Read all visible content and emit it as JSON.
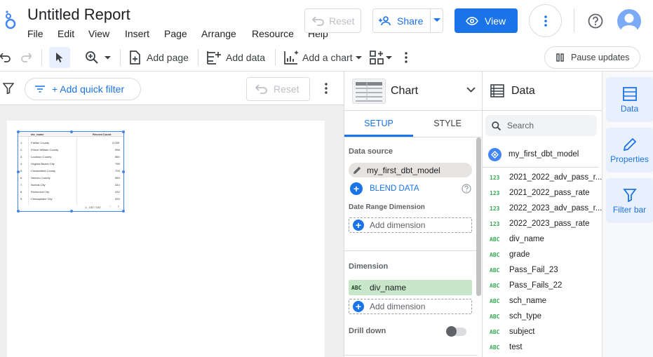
{
  "app": {
    "title": "Untitled Report",
    "menu": [
      "File",
      "Edit",
      "View",
      "Insert",
      "Page",
      "Arrange",
      "Resource",
      "Help"
    ],
    "reset_label": "Reset",
    "share_label": "Share",
    "view_label": "View"
  },
  "toolbar": {
    "add_page": "Add page",
    "add_data": "Add data",
    "add_chart": "Add a chart",
    "pause_updates": "Pause updates"
  },
  "filterbar": {
    "add_quick_filter": "+ Add quick filter",
    "reset_label": "Reset"
  },
  "table": {
    "headers": [
      "div_name",
      "Record Count"
    ],
    "rows": [
      [
        "1.",
        "Fairfax County",
        "2,039"
      ],
      [
        "2.",
        "Prince William County",
        "958"
      ],
      [
        "3.",
        "Loudoun County",
        "860"
      ],
      [
        "4.",
        "Virginia Beach City",
        "795"
      ],
      [
        "5.",
        "Chesterfield County",
        "709"
      ],
      [
        "6.",
        "Henrico County",
        "589"
      ],
      [
        "7.",
        "Norfolk City",
        "444"
      ],
      [
        "8.",
        "Richmond City",
        "432"
      ],
      [
        "9.",
        "Chesapeake City",
        "393"
      ]
    ],
    "pagination": "1 - 132 / 132"
  },
  "chart_panel": {
    "title": "Chart",
    "tab_setup": "SETUP",
    "tab_style": "STYLE",
    "data_source_label": "Data source",
    "data_source": "my_first_dbt_model",
    "blend_data": "BLEND DATA",
    "date_range_label": "Date Range Dimension",
    "add_dimension": "Add dimension",
    "dimension_label": "Dimension",
    "dimension_value": "div_name",
    "dimension_type": "ABC",
    "drill_down_label": "Drill down"
  },
  "data_panel": {
    "title": "Data",
    "search_placeholder": "Search",
    "source": "my_first_dbt_model",
    "fields": [
      {
        "type": "123",
        "name": "2021_2022_adv_pass_r..."
      },
      {
        "type": "123",
        "name": "2021_2022_pass_rate"
      },
      {
        "type": "123",
        "name": "2022_2023_adv_pass_r..."
      },
      {
        "type": "123",
        "name": "2022_2023_pass_rate"
      },
      {
        "type": "ABC",
        "name": "div_name"
      },
      {
        "type": "ABC",
        "name": "grade"
      },
      {
        "type": "ABC",
        "name": "Pass_Fail_23"
      },
      {
        "type": "ABC",
        "name": "Pass_Fails_22"
      },
      {
        "type": "ABC",
        "name": "sch_name"
      },
      {
        "type": "ABC",
        "name": "sch_type"
      },
      {
        "type": "ABC",
        "name": "subject"
      },
      {
        "type": "ABC",
        "name": "test"
      }
    ]
  },
  "rail": {
    "data": "Data",
    "properties": "Properties",
    "filter_bar": "Filter bar"
  },
  "colors": {
    "accent": "#1a73e8",
    "field_green": "#34a853",
    "dimension_chip": "#c8e6c9"
  }
}
